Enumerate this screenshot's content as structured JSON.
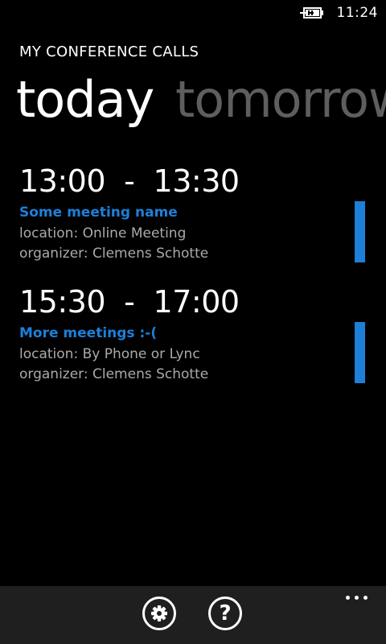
{
  "status_bar": {
    "time": "11:24",
    "battery_icon": "battery-charging-icon"
  },
  "app": {
    "title": "MY CONFERENCE CALLS"
  },
  "pivot": {
    "tabs": [
      {
        "label": "today",
        "active": true
      },
      {
        "label": "tomorrow",
        "active": false
      }
    ]
  },
  "meetings": [
    {
      "time": "13:00  -  13:30",
      "name": "Some meeting name",
      "location": "location: Online Meeting",
      "organizer": "organizer: Clemens Schotte"
    },
    {
      "time": "15:30  -  17:00",
      "name": "More meetings :-(",
      "location": "location: By Phone or Lync",
      "organizer": "organizer: Clemens Schotte"
    }
  ],
  "app_bar": {
    "buttons": [
      {
        "icon": "gear-icon"
      },
      {
        "icon": "help-icon",
        "glyph": "?"
      }
    ],
    "more_icon": "ellipsis-icon"
  },
  "colors": {
    "background": "#000000",
    "accent": "#1e7fd8",
    "secondary_text": "#aaaaaa",
    "inactive_header": "#5e5e5e",
    "app_bar": "#1f1f1f"
  }
}
